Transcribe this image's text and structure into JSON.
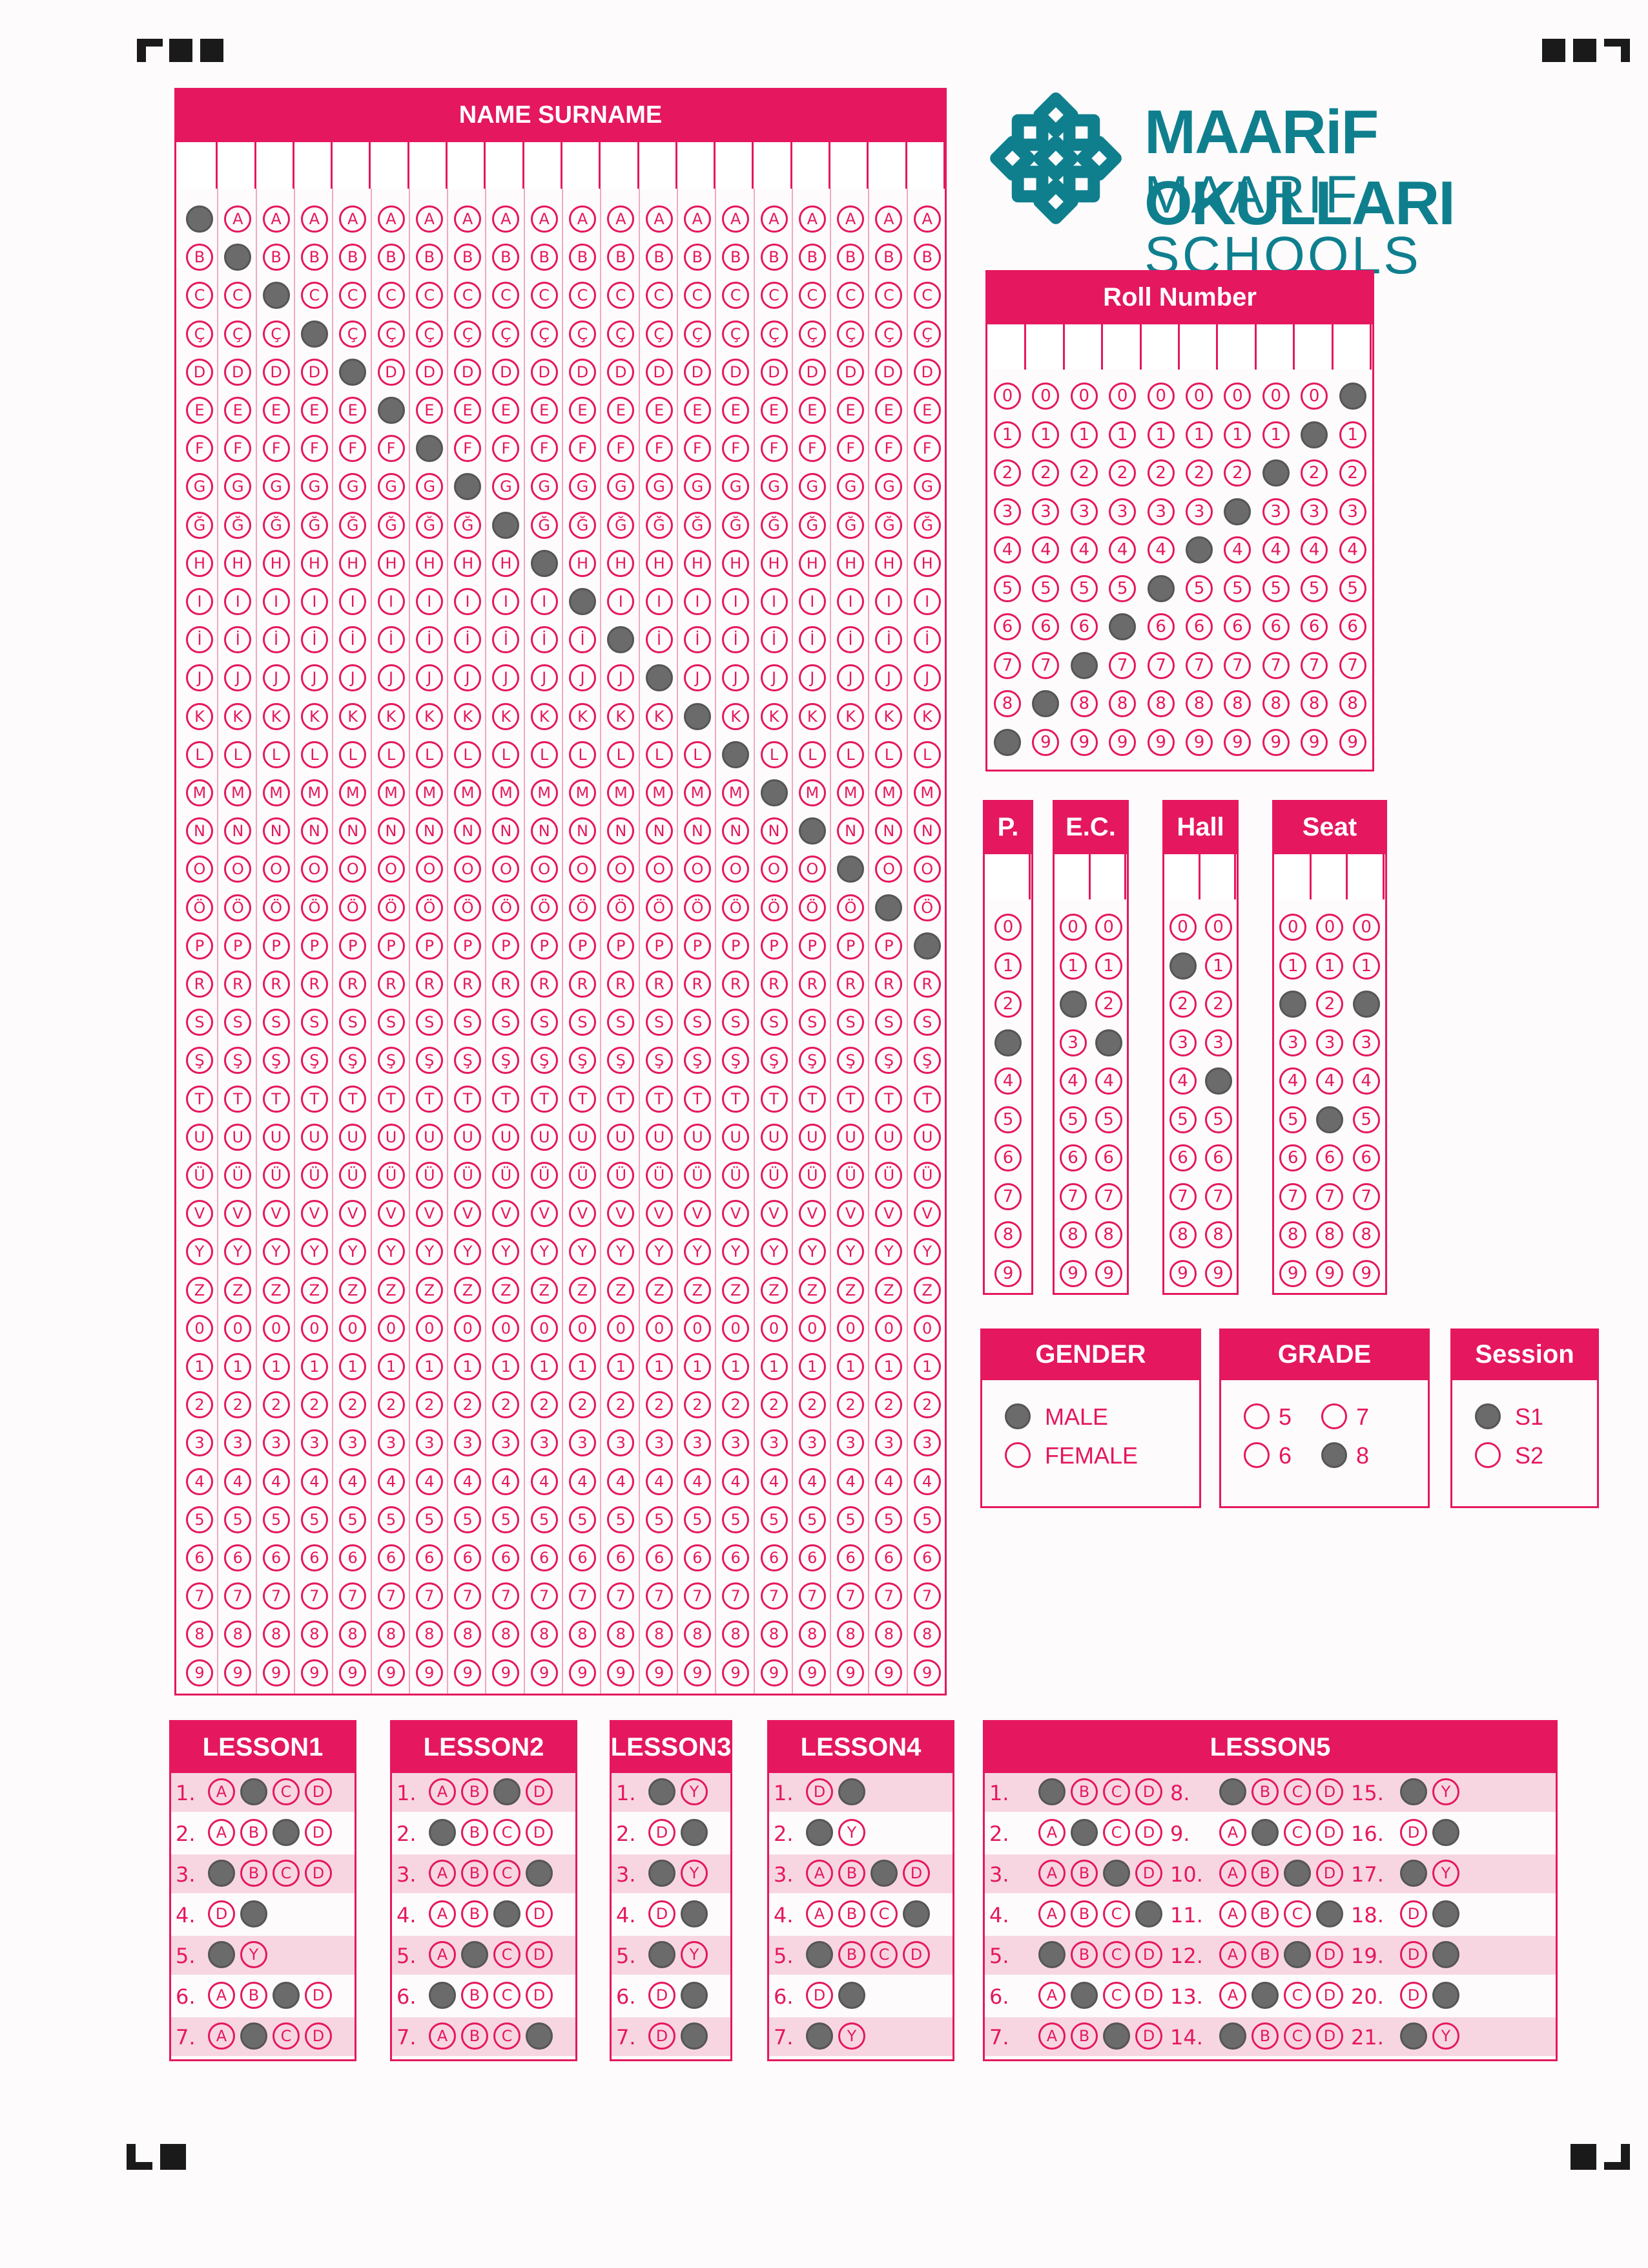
{
  "logo": {
    "title": "MAARiF OKULLARI",
    "subtitle": "MAARIF SCHOOLS",
    "icon": "maarif-logo-icon",
    "color": "#0f7f8e"
  },
  "accent": "#e5175f",
  "name_section": {
    "title": "NAME SURNAME",
    "letters": [
      "A",
      "B",
      "C",
      "Ç",
      "D",
      "E",
      "F",
      "G",
      "Ğ",
      "H",
      "I",
      "İ",
      "J",
      "K",
      "L",
      "M",
      "N",
      "O",
      "Ö",
      "P",
      "R",
      "S",
      "Ş",
      "T",
      "U",
      "Ü",
      "V",
      "Y",
      "Z",
      "0",
      "1",
      "2",
      "3",
      "4",
      "5",
      "6",
      "7",
      "8",
      "9"
    ],
    "filled_rows": [
      0,
      1,
      2,
      3,
      4,
      5,
      6,
      7,
      8,
      9,
      10,
      11,
      12,
      13,
      14,
      15,
      16,
      17,
      18,
      19
    ]
  },
  "roll_number": {
    "title": "Roll Number",
    "digits": [
      "0",
      "1",
      "2",
      "3",
      "4",
      "5",
      "6",
      "7",
      "8",
      "9"
    ],
    "filled": [
      9,
      8,
      7,
      6,
      5,
      4,
      3,
      2,
      1,
      0
    ]
  },
  "p": {
    "title": "P.",
    "filled": [
      3
    ]
  },
  "ec": {
    "title": "E.C.",
    "filled": [
      2,
      3
    ]
  },
  "hall": {
    "title": "Hall",
    "filled": [
      1,
      4
    ]
  },
  "seat": {
    "title": "Seat",
    "filled": [
      2,
      5,
      2
    ]
  },
  "gender": {
    "title": "GENDER",
    "options": [
      "MALE",
      "FEMALE"
    ],
    "selected": 0
  },
  "grade": {
    "title": "GRADE",
    "options": [
      "5",
      "7",
      "6",
      "8"
    ],
    "selected": 3
  },
  "session": {
    "title": "Session",
    "options": [
      "S1",
      "S2"
    ],
    "selected": 0
  },
  "lessons": [
    {
      "title": "LESSON1",
      "questions": [
        {
          "n": "1.",
          "opts": [
            "A",
            "B",
            "C",
            "D"
          ],
          "filled": 1
        },
        {
          "n": "2.",
          "opts": [
            "A",
            "B",
            "C",
            "D"
          ],
          "filled": 2
        },
        {
          "n": "3.",
          "opts": [
            "A",
            "B",
            "C",
            "D"
          ],
          "filled": 0
        },
        {
          "n": "4.",
          "opts": [
            "D",
            "Y"
          ],
          "filled": 1
        },
        {
          "n": "5.",
          "opts": [
            "D",
            "Y"
          ],
          "filled": 0
        },
        {
          "n": "6.",
          "opts": [
            "A",
            "B",
            "C",
            "D"
          ],
          "filled": 2
        },
        {
          "n": "7.",
          "opts": [
            "A",
            "B",
            "C",
            "D"
          ],
          "filled": 1
        }
      ]
    },
    {
      "title": "LESSON2",
      "questions": [
        {
          "n": "1.",
          "opts": [
            "A",
            "B",
            "C",
            "D"
          ],
          "filled": 2
        },
        {
          "n": "2.",
          "opts": [
            "A",
            "B",
            "C",
            "D"
          ],
          "filled": 0
        },
        {
          "n": "3.",
          "opts": [
            "A",
            "B",
            "C",
            "D"
          ],
          "filled": 3
        },
        {
          "n": "4.",
          "opts": [
            "A",
            "B",
            "C",
            "D"
          ],
          "filled": 2
        },
        {
          "n": "5.",
          "opts": [
            "A",
            "B",
            "C",
            "D"
          ],
          "filled": 1
        },
        {
          "n": "6.",
          "opts": [
            "A",
            "B",
            "C",
            "D"
          ],
          "filled": 0
        },
        {
          "n": "7.",
          "opts": [
            "A",
            "B",
            "C",
            "D"
          ],
          "filled": 3
        }
      ]
    },
    {
      "title": "LESSON3",
      "questions": [
        {
          "n": "1.",
          "opts": [
            "D",
            "Y"
          ],
          "filled": 0
        },
        {
          "n": "2.",
          "opts": [
            "D",
            "Y"
          ],
          "filled": 1
        },
        {
          "n": "3.",
          "opts": [
            "D",
            "Y"
          ],
          "filled": 0
        },
        {
          "n": "4.",
          "opts": [
            "D",
            "Y"
          ],
          "filled": 1
        },
        {
          "n": "5.",
          "opts": [
            "D",
            "Y"
          ],
          "filled": 0
        },
        {
          "n": "6.",
          "opts": [
            "D",
            "Y"
          ],
          "filled": 1
        },
        {
          "n": "7.",
          "opts": [
            "D",
            "Y"
          ],
          "filled": 1
        }
      ]
    },
    {
      "title": "LESSON4",
      "questions": [
        {
          "n": "1.",
          "opts": [
            "D",
            "Y"
          ],
          "filled": 1
        },
        {
          "n": "2.",
          "opts": [
            "D",
            "Y"
          ],
          "filled": 0
        },
        {
          "n": "3.",
          "opts": [
            "A",
            "B",
            "C",
            "D"
          ],
          "filled": 2
        },
        {
          "n": "4.",
          "opts": [
            "A",
            "B",
            "C",
            "D"
          ],
          "filled": 3
        },
        {
          "n": "5.",
          "opts": [
            "A",
            "B",
            "C",
            "D"
          ],
          "filled": 0
        },
        {
          "n": "6.",
          "opts": [
            "D",
            "Y"
          ],
          "filled": 1
        },
        {
          "n": "7.",
          "opts": [
            "D",
            "Y"
          ],
          "filled": 0
        }
      ]
    },
    {
      "title": "LESSON5",
      "questions": [
        {
          "n": "1.",
          "opts": [
            "A",
            "B",
            "C",
            "D"
          ],
          "filled": 0
        },
        {
          "n": "2.",
          "opts": [
            "A",
            "B",
            "C",
            "D"
          ],
          "filled": 1
        },
        {
          "n": "3.",
          "opts": [
            "A",
            "B",
            "C",
            "D"
          ],
          "filled": 2
        },
        {
          "n": "4.",
          "opts": [
            "A",
            "B",
            "C",
            "D"
          ],
          "filled": 3
        },
        {
          "n": "5.",
          "opts": [
            "A",
            "B",
            "C",
            "D"
          ],
          "filled": 0
        },
        {
          "n": "6.",
          "opts": [
            "A",
            "B",
            "C",
            "D"
          ],
          "filled": 1
        },
        {
          "n": "7.",
          "opts": [
            "A",
            "B",
            "C",
            "D"
          ],
          "filled": 2
        },
        {
          "n": "8.",
          "opts": [
            "A",
            "B",
            "C",
            "D"
          ],
          "filled": 0
        },
        {
          "n": "9.",
          "opts": [
            "A",
            "B",
            "C",
            "D"
          ],
          "filled": 1
        },
        {
          "n": "10.",
          "opts": [
            "A",
            "B",
            "C",
            "D"
          ],
          "filled": 2
        },
        {
          "n": "11.",
          "opts": [
            "A",
            "B",
            "C",
            "D"
          ],
          "filled": 3
        },
        {
          "n": "12.",
          "opts": [
            "A",
            "B",
            "C",
            "D"
          ],
          "filled": 2
        },
        {
          "n": "13.",
          "opts": [
            "A",
            "B",
            "C",
            "D"
          ],
          "filled": 1
        },
        {
          "n": "14.",
          "opts": [
            "A",
            "B",
            "C",
            "D"
          ],
          "filled": 0
        },
        {
          "n": "15.",
          "opts": [
            "D",
            "Y"
          ],
          "filled": 0
        },
        {
          "n": "16.",
          "opts": [
            "D",
            "Y"
          ],
          "filled": 1
        },
        {
          "n": "17.",
          "opts": [
            "D",
            "Y"
          ],
          "filled": 0
        },
        {
          "n": "18.",
          "opts": [
            "D",
            "Y"
          ],
          "filled": 1
        },
        {
          "n": "19.",
          "opts": [
            "D",
            "Y"
          ],
          "filled": 1
        },
        {
          "n": "20.",
          "opts": [
            "D",
            "Y"
          ],
          "filled": 1
        },
        {
          "n": "21.",
          "opts": [
            "D",
            "Y"
          ],
          "filled": 0
        }
      ]
    }
  ]
}
